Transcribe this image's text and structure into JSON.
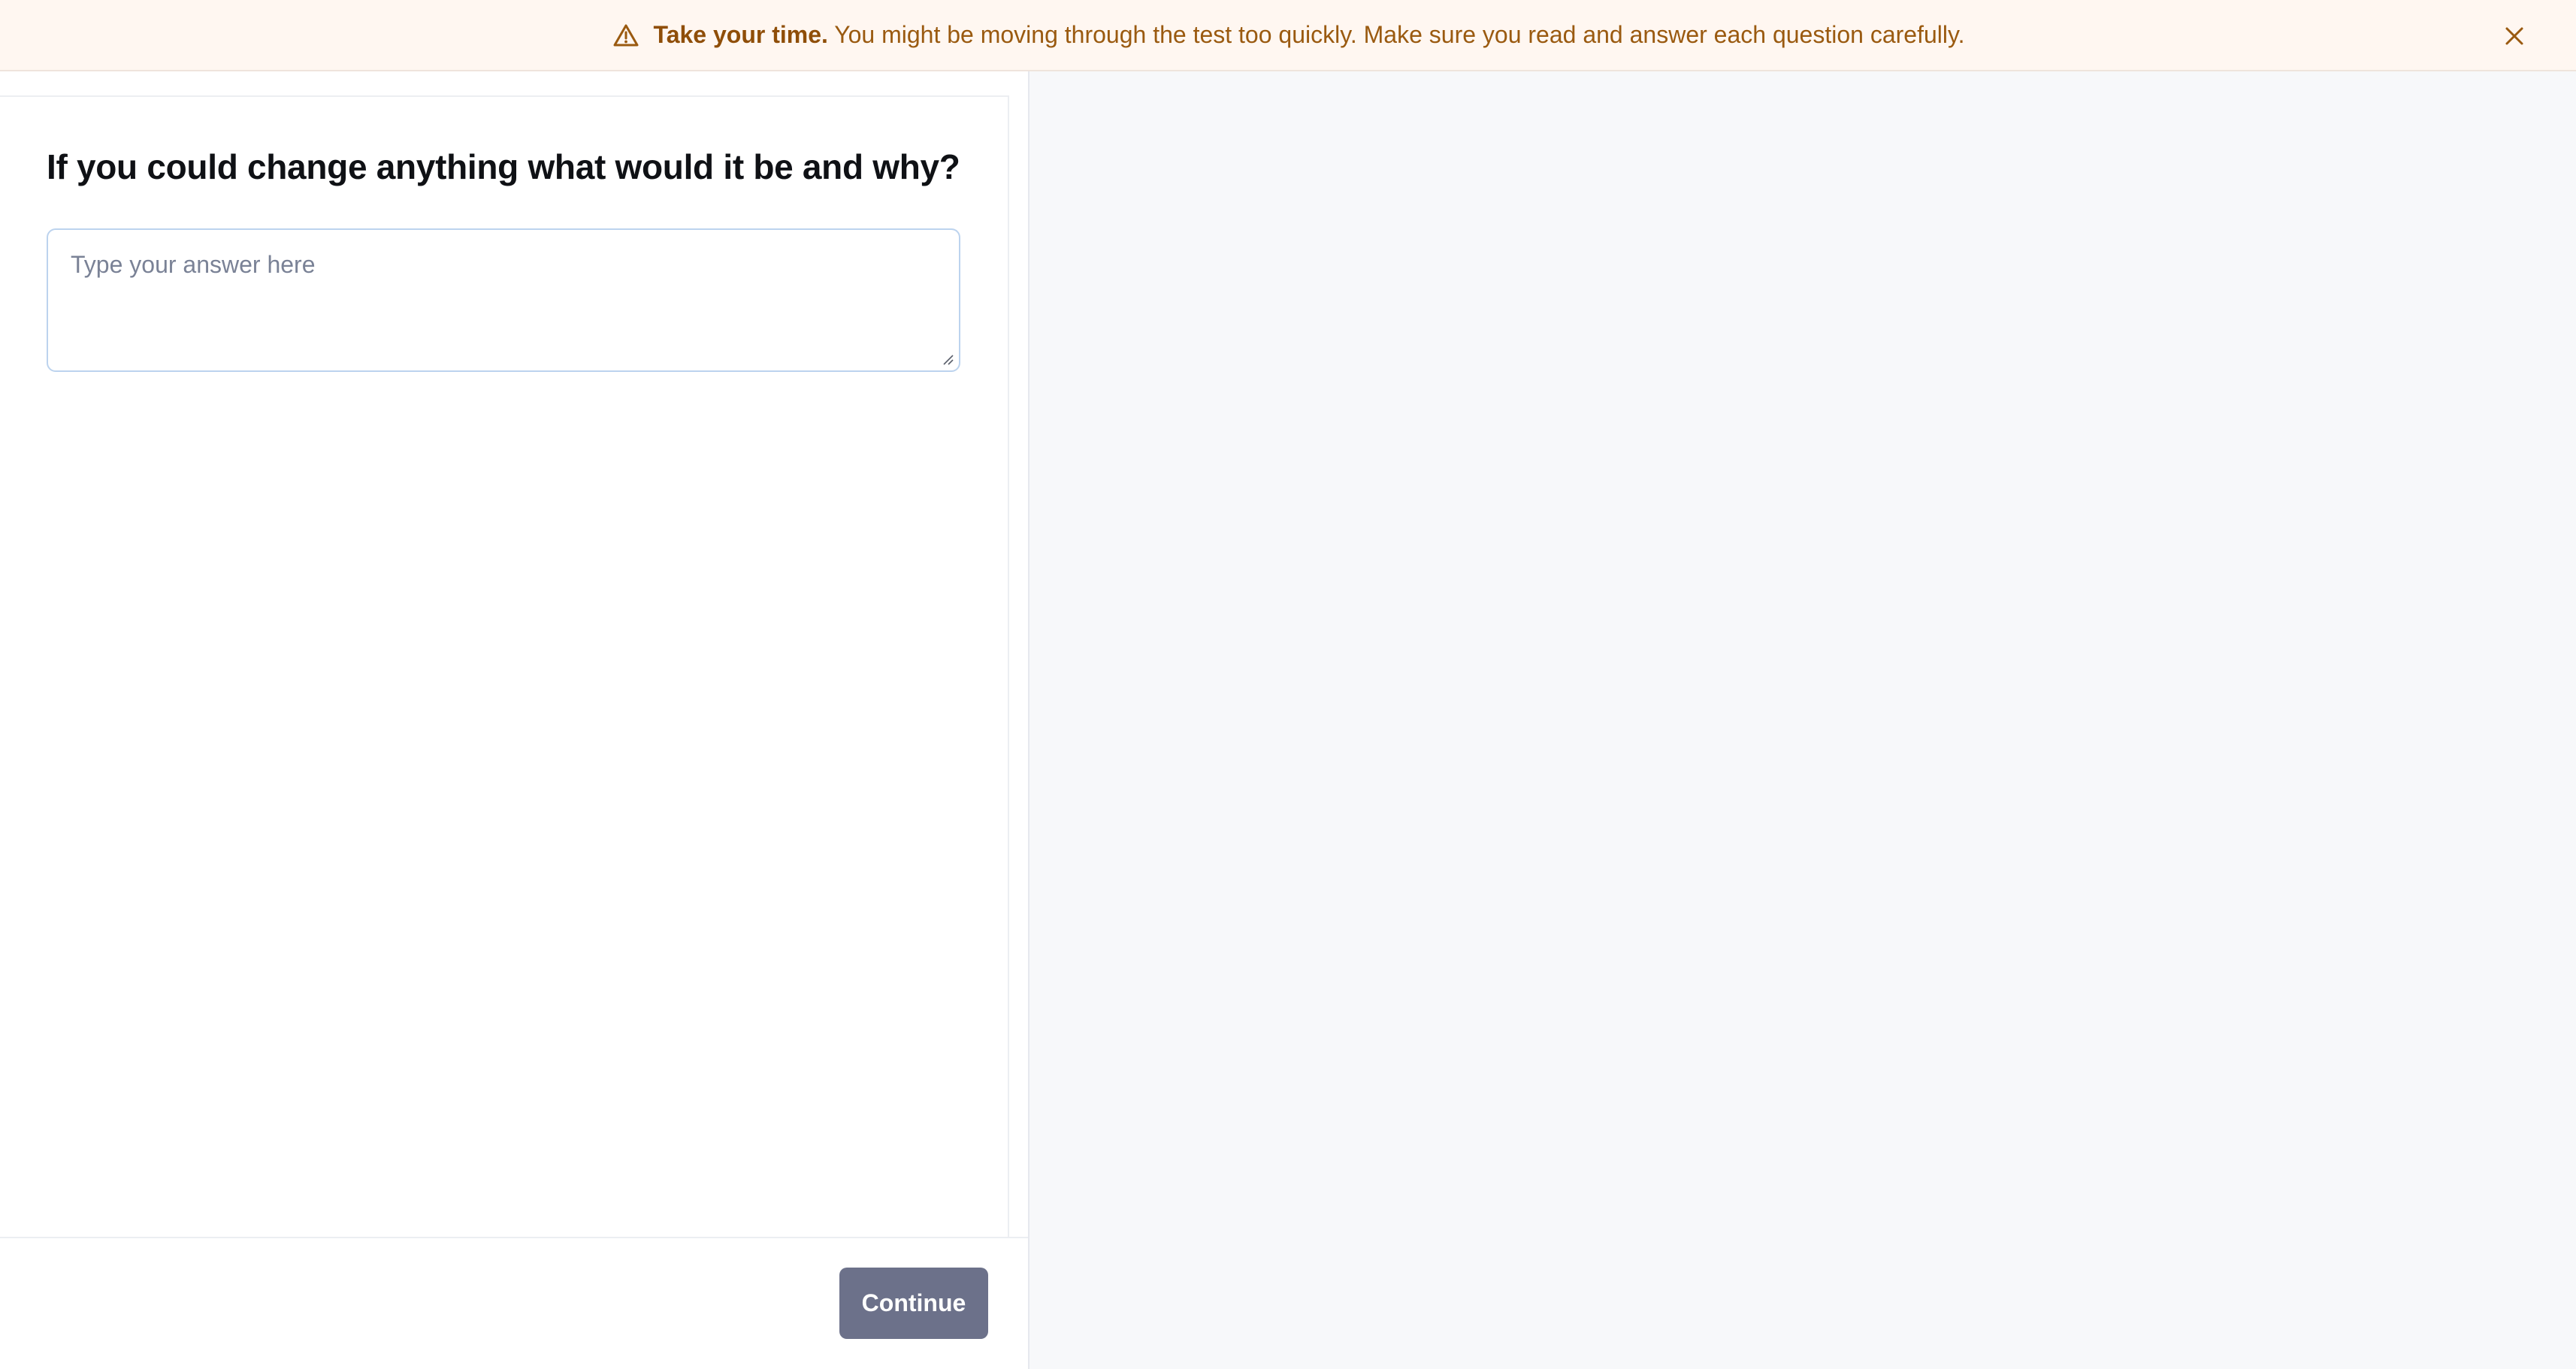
{
  "banner": {
    "strong": "Take your time.",
    "message": "You might be moving through the test too quickly. Make sure you read and answer each question carefully.",
    "icon": "warning-icon",
    "close_icon": "close-icon"
  },
  "question": {
    "title": "If you could change anything what would it be and why?",
    "answer_value": "",
    "answer_placeholder": "Type your answer here"
  },
  "footer": {
    "continue_label": "Continue"
  },
  "colors": {
    "banner_bg": "#fff7f1",
    "banner_text": "#9a5a10",
    "button_bg": "#6c718a",
    "input_border": "#bcd3ee",
    "page_bg": "#f7f8fa"
  }
}
